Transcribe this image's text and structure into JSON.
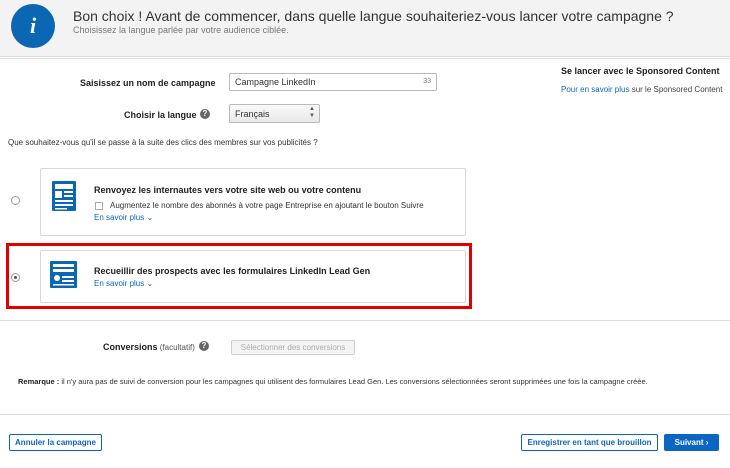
{
  "header": {
    "title": "Bon choix ! Avant de commencer, dans quelle langue souhaiteriez-vous lancer votre campagne ?",
    "subtitle": "Choisissez la langue parlée par votre audience ciblée.",
    "info_icon": "i"
  },
  "form": {
    "campaign_name_label": "Saisissez un nom de campagne",
    "campaign_name_value": "Campagne LinkedIn",
    "campaign_name_count": "33",
    "language_label": "Choisir la langue",
    "language_value": "Français",
    "help_icon": "?"
  },
  "side": {
    "title": "Se lancer avec le Sponsored Content",
    "link": "Pour en savoir plus",
    "text": " sur le Sponsored Content"
  },
  "question": "Que souhaitez-vous qu'il se passe à la suite des clics des membres sur vos publicités ?",
  "options": [
    {
      "title": "Renvoyez les internautes vers votre site web ou votre contenu",
      "checkbox_label": "Augmentez le nombre des abonnés à votre page Entreprise en ajoutant le bouton Suivre",
      "link": "En savoir plus",
      "selected": false,
      "icon": "website-icon"
    },
    {
      "title": "Recueillir des prospects avec les formulaires LinkedIn Lead Gen",
      "link": "En savoir plus",
      "selected": true,
      "icon": "lead-form-icon"
    }
  ],
  "conversions": {
    "label": "Conversions",
    "optional": " (facultatif)",
    "button": "Sélectionner des conversions"
  },
  "remark": {
    "label": "Remarque :",
    "text": " il n'y aura pas de suivi de conversion pour les campagnes qui utilisent des formulaires Lead Gen. Les conversions sélectionnées seront supprimées une fois la campagne créée."
  },
  "footer": {
    "cancel": "Annuler la campagne",
    "draft": "Enregistrer en tant que brouillon",
    "next": "Suivant ›"
  },
  "colors": {
    "accent": "#0a66c2",
    "highlight": "#e00000",
    "icon_blue": "#0b66b3"
  }
}
